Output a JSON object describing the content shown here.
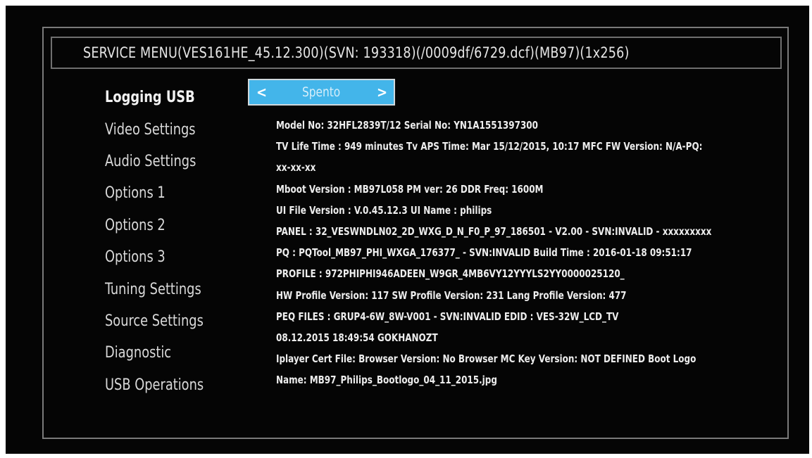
{
  "title": "SERVICE MENU(VES161HE_45.12.300)(SVN: 193318)(/0009df/6729.dcf)(MB97)(1x256)",
  "menu": [
    {
      "label": "Logging USB",
      "active": true
    },
    {
      "label": "Video Settings",
      "active": false
    },
    {
      "label": "Audio Settings",
      "active": false
    },
    {
      "label": "Options 1",
      "active": false
    },
    {
      "label": "Options 2",
      "active": false
    },
    {
      "label": "Options 3",
      "active": false
    },
    {
      "label": "Tuning Settings",
      "active": false
    },
    {
      "label": "Source Settings",
      "active": false
    },
    {
      "label": "Diagnostic",
      "active": false
    },
    {
      "label": "USB Operations",
      "active": false
    }
  ],
  "selector": {
    "left_arrow": "<",
    "value": "Spento",
    "right_arrow": ">"
  },
  "info_lines": [
    "Model No: 32HFL2839T/12  Serial No: YN1A1551397300",
    "TV Life Time : 949 minutes  Tv APS Time: Mar 15/12/2015, 10:17 MFC FW Version: N/A-PQ:",
    "xx-xx-xx",
    "Mboot Version : MB97L058 PM ver: 26 DDR Freq: 1600M",
    "UI File Version : V.0.45.12.3  UI Name : philips",
    "PANEL : 32_VESWNDLN02_2D_WXG_D_N_F0_P_97_186501 - V2.00 - SVN:INVALID - xxxxxxxxx",
    "PQ : PQTool_MB97_PHI_WXGA_176377_ - SVN:INVALID  Build Time : 2016-01-18 09:51:17",
    "PROFILE : 972PHIPHI946ADEEN_W9GR_4MB6VY12YYYLS2YY0000025120_",
    "HW Profile Version: 117  SW Profile Version: 231  Lang Profile Version: 477",
    "PEQ FILES : GRUP4-6W_8W-V001 - SVN:INVALID    EDID : VES-32W_LCD_TV",
    "08.12.2015 18:49:54 GOKHANOZT",
    "Iplayer Cert File:  Browser Version: No Browser  MC Key Version: NOT DEFINED  Boot Logo",
    "Name: MB97_Philips_Bootlogo_04_11_2015.jpg"
  ],
  "colors": {
    "background": "#050505",
    "selector_fill": "#43b5ea",
    "frame": "#7a7a7a",
    "text": "#ededed"
  }
}
